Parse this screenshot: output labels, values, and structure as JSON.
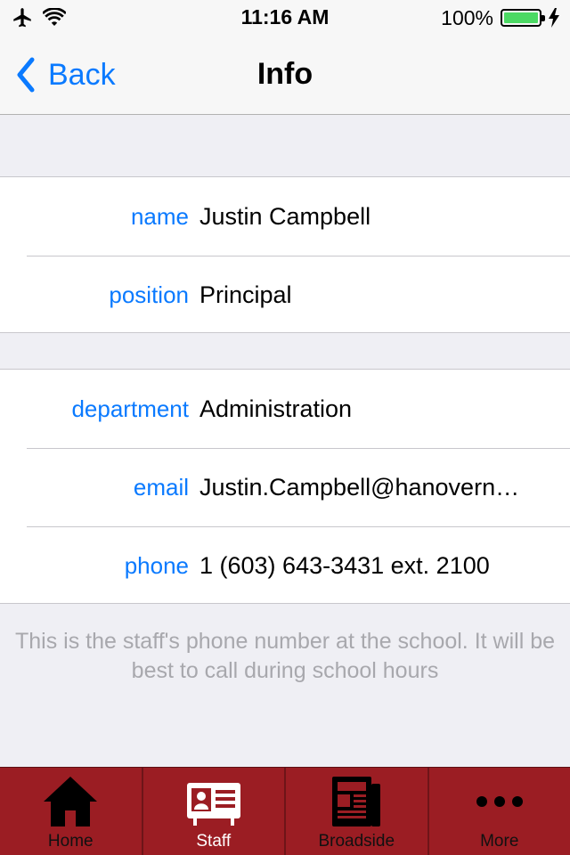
{
  "status_bar": {
    "time": "11:16 AM",
    "battery_percent": "100%",
    "battery_level": 1.0,
    "icons": [
      "airplane-mode-icon",
      "wifi-icon",
      "battery-icon",
      "charging-bolt-icon"
    ]
  },
  "nav": {
    "back_label": "Back",
    "title": "Info"
  },
  "groups": [
    {
      "rows": [
        {
          "label": "name",
          "value": "Justin Campbell"
        },
        {
          "label": "position",
          "value": "Principal"
        }
      ]
    },
    {
      "rows": [
        {
          "label": "department",
          "value": "Administration"
        },
        {
          "label": "email",
          "value": "Justin.Campbell@hanovern…"
        },
        {
          "label": "phone",
          "value": "1 (603) 643-3431 ext. 2100"
        }
      ]
    }
  ],
  "footer_note": "This is the staff's phone number at the school. It will be best to call during school hours",
  "tabs": [
    {
      "label": "Home",
      "icon": "home-icon",
      "active": false
    },
    {
      "label": "Staff",
      "icon": "staff-id-card-icon",
      "active": true
    },
    {
      "label": "Broadside",
      "icon": "newspaper-icon",
      "active": false
    },
    {
      "label": "More",
      "icon": "more-dots-icon",
      "active": false
    }
  ],
  "colors": {
    "accent": "#0a7aff",
    "tab_bar": "#9b1d23",
    "battery_fill": "#4cd964",
    "footer_text": "#a8a8ad"
  }
}
